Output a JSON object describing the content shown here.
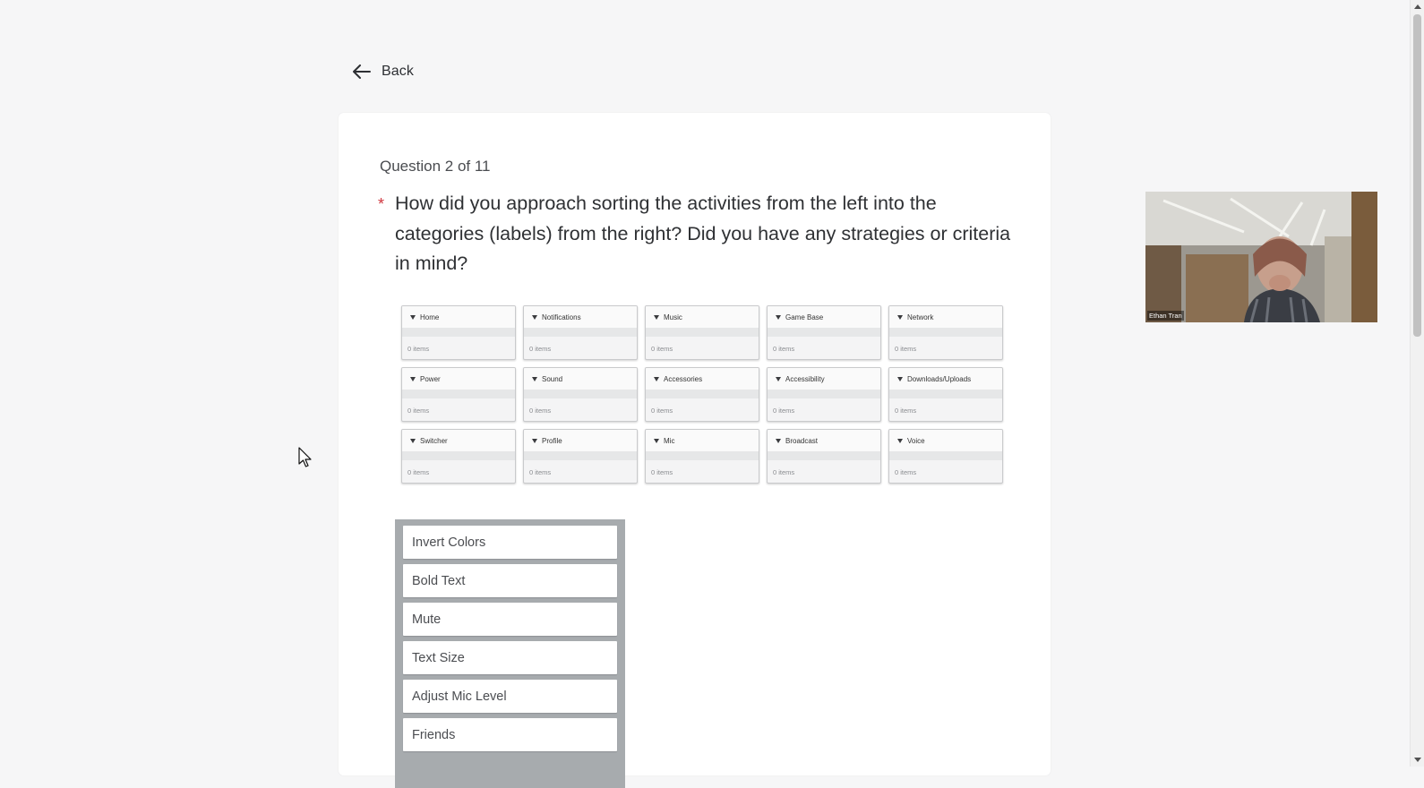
{
  "nav": {
    "back_label": "Back"
  },
  "question": {
    "counter": "Question 2 of 11",
    "required_mark": "*",
    "text": "How did you approach sorting the activities from the left into the categories (labels) from the right? Did you have any strategies or criteria in mind?"
  },
  "categories": [
    {
      "label": "Home",
      "count": "0 items"
    },
    {
      "label": "Notifications",
      "count": "0 items"
    },
    {
      "label": "Music",
      "count": "0 items"
    },
    {
      "label": "Game Base",
      "count": "0 items"
    },
    {
      "label": "Network",
      "count": "0 items"
    },
    {
      "label": "Power",
      "count": "0 items"
    },
    {
      "label": "Sound",
      "count": "0 items"
    },
    {
      "label": "Accessories",
      "count": "0 items"
    },
    {
      "label": "Accessibility",
      "count": "0 items"
    },
    {
      "label": "Downloads/Uploads",
      "count": "0 items"
    },
    {
      "label": "Switcher",
      "count": "0 items"
    },
    {
      "label": "Profile",
      "count": "0 items"
    },
    {
      "label": "Mic",
      "count": "0 items"
    },
    {
      "label": "Broadcast",
      "count": "0 items"
    },
    {
      "label": "Voice",
      "count": "0 items"
    }
  ],
  "items": [
    {
      "label": "Invert Colors"
    },
    {
      "label": "Bold Text"
    },
    {
      "label": "Mute"
    },
    {
      "label": "Text Size"
    },
    {
      "label": "Adjust Mic Level"
    },
    {
      "label": "Friends"
    }
  ],
  "video": {
    "participant_name": "Ethan Tran"
  },
  "icons": {
    "back": "arrow-left-icon",
    "category_toggle": "caret-down-icon",
    "cursor": "mouse-pointer-icon"
  },
  "colors": {
    "background": "#f6f6f7",
    "card": "#ffffff",
    "required": "#d0373f",
    "items_panel": "#a7abae"
  }
}
